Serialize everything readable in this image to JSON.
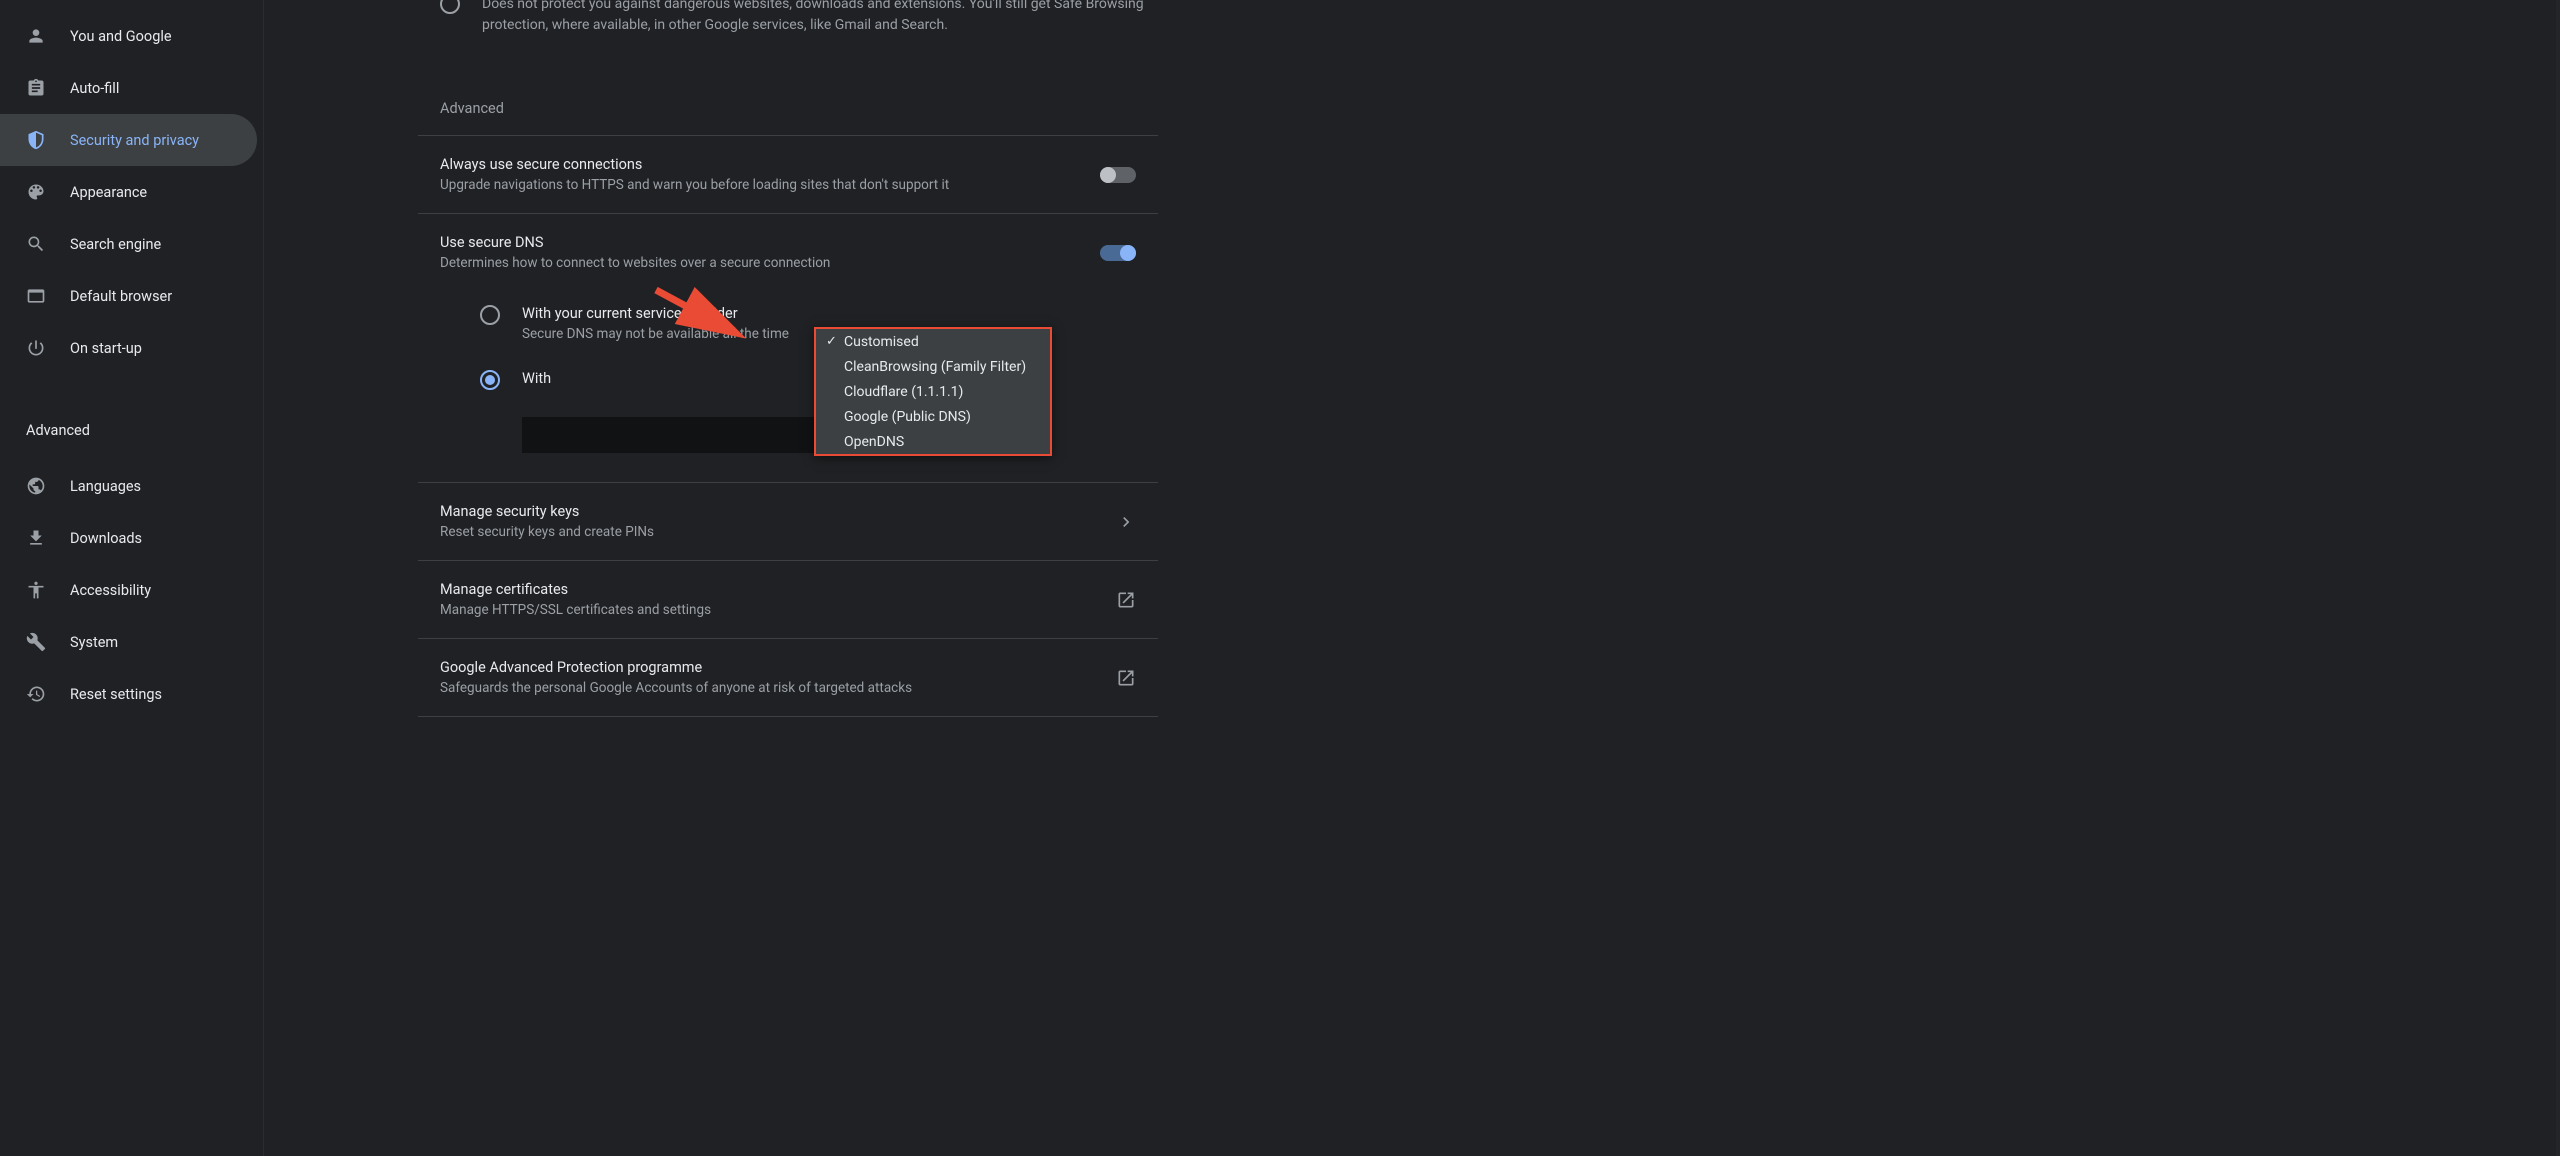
{
  "sidebar": {
    "items": [
      {
        "label": "You and Google",
        "icon": "person"
      },
      {
        "label": "Auto-fill",
        "icon": "clipboard"
      },
      {
        "label": "Security and privacy",
        "icon": "shield",
        "active": true
      },
      {
        "label": "Appearance",
        "icon": "palette"
      },
      {
        "label": "Search engine",
        "icon": "search"
      },
      {
        "label": "Default browser",
        "icon": "browser"
      },
      {
        "label": "On start-up",
        "icon": "power"
      }
    ],
    "advanced_label": "Advanced",
    "advanced_items": [
      {
        "label": "Languages",
        "icon": "globe"
      },
      {
        "label": "Downloads",
        "icon": "download"
      },
      {
        "label": "Accessibility",
        "icon": "accessibility"
      },
      {
        "label": "System",
        "icon": "wrench"
      },
      {
        "label": "Reset settings",
        "icon": "history"
      }
    ]
  },
  "main": {
    "truncated_text": "Does not protect you against dangerous websites, downloads and extensions. You'll still get Safe Browsing protection, where available, in other Google services, like Gmail and Search.",
    "section_header": "Advanced",
    "rows": {
      "secure_connections": {
        "title": "Always use secure connections",
        "desc": "Upgrade navigations to HTTPS and warn you before loading sites that don't support it"
      },
      "secure_dns": {
        "title": "Use secure DNS",
        "desc": "Determines how to connect to websites over a secure connection",
        "option1": {
          "title": "With your current service provider",
          "desc": "Secure DNS may not be available all the time"
        },
        "option2": {
          "title": "With"
        }
      },
      "security_keys": {
        "title": "Manage security keys",
        "desc": "Reset security keys and create PINs"
      },
      "certificates": {
        "title": "Manage certificates",
        "desc": "Manage HTTPS/SSL certificates and settings"
      },
      "protection": {
        "title": "Google Advanced Protection programme",
        "desc": "Safeguards the personal Google Accounts of anyone at risk of targeted attacks"
      }
    },
    "dropdown": {
      "options": [
        "Customised",
        "CleanBrowsing (Family Filter)",
        "Cloudflare (1.1.1.1)",
        "Google (Public DNS)",
        "OpenDNS"
      ],
      "selected_index": 0
    }
  }
}
